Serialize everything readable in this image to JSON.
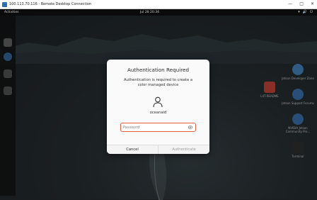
{
  "window": {
    "title": "100.113.70.116 - Remote Desktop Connection",
    "controls": [
      "—",
      "□",
      "✕"
    ]
  },
  "topbar": {
    "activities": "Activities",
    "clock": "Jul 28  20:34",
    "tray": [
      "▾",
      "🔊",
      "⏻"
    ]
  },
  "dock": {
    "items": [
      {
        "name": "files-icon",
        "color": "#6b6b6b"
      },
      {
        "name": "firefox-icon",
        "color": "#3a6ea5"
      },
      {
        "name": "app-icon",
        "color": "#5a5a5a"
      },
      {
        "name": "settings-icon",
        "color": "#5a5a5a"
      }
    ]
  },
  "desktop_icons": [
    {
      "label": "Jetson Developer Zone",
      "color": "#4a8cc9"
    },
    {
      "label": "L4T-README",
      "color": "#d24a3c"
    },
    {
      "label": "Jetson Support Forums",
      "color": "#3f7ab8"
    },
    {
      "label": "NVIDIA Jetson Community Pro...",
      "color": "#3f7ab8"
    },
    {
      "label": "Terminal",
      "color": "#333333"
    }
  ],
  "dialog": {
    "title": "Authentication Required",
    "message": "Authentication is required to create a color managed device",
    "username": "oceanaid",
    "password_placeholder": "Password",
    "cancel_label": "Cancel",
    "authenticate_label": "Authenticate",
    "accent_color": "#e0623a"
  }
}
